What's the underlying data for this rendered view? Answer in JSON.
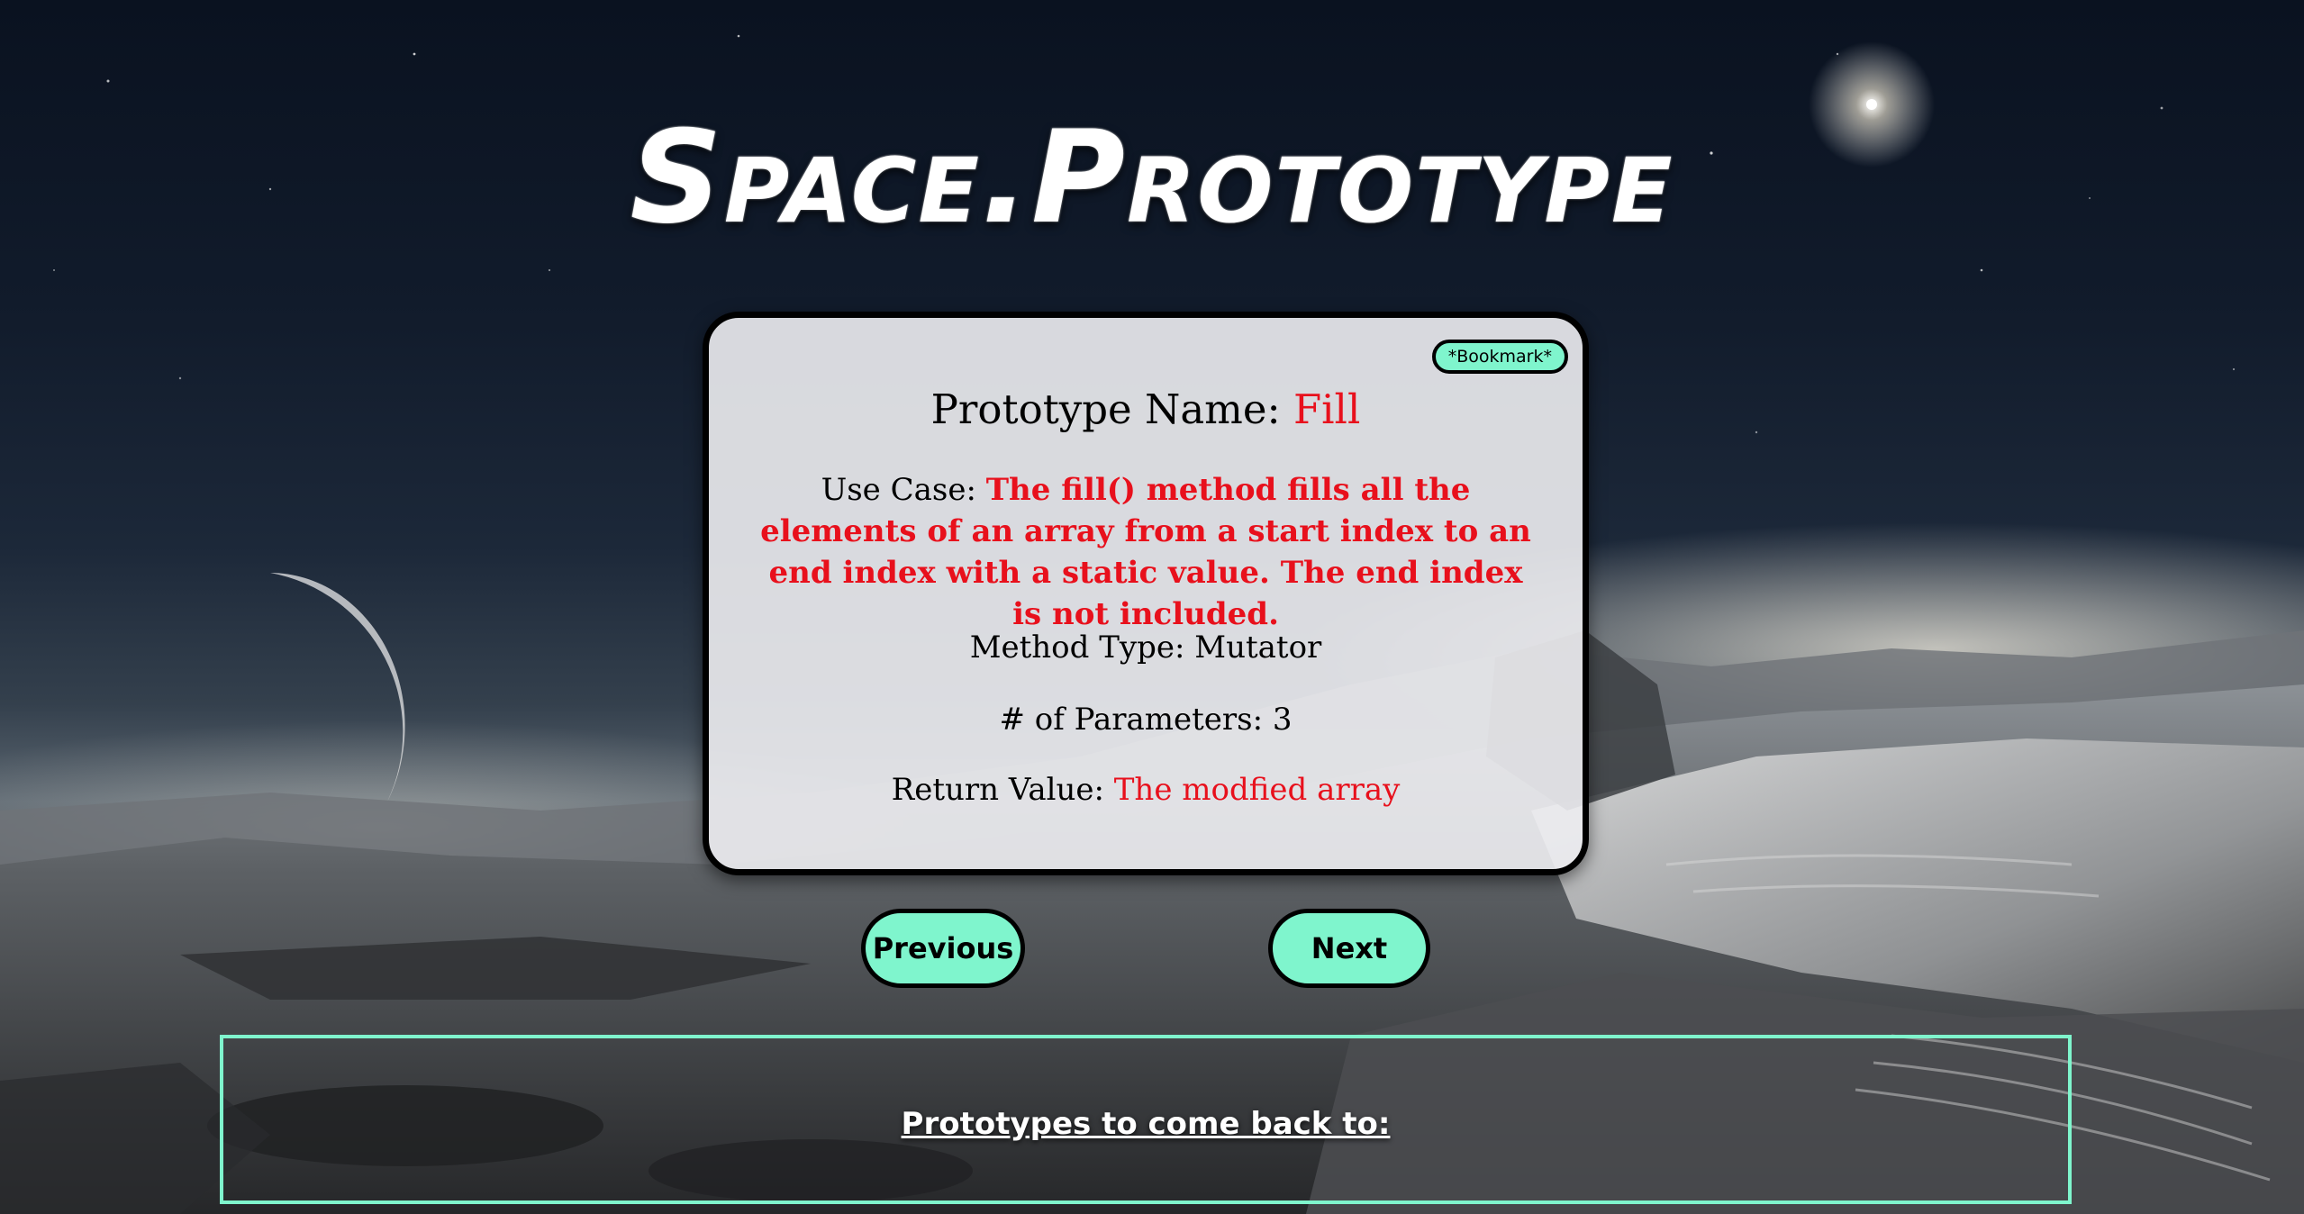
{
  "header": {
    "title": "Space.Prototype"
  },
  "card": {
    "bookmark_label": "*Bookmark*",
    "name_label": "Prototype Name:",
    "name_value": "Fill",
    "use_case_label": "Use Case:",
    "use_case_value": "The fill() method fills all the elements of an array from a start index to an end index with a static value. The end index is not included.",
    "method_type_label": "Method Type:",
    "method_type_value": "Mutator",
    "params_label": "# of Parameters:",
    "params_value": "3",
    "return_label": "Return Value:",
    "return_value": "The modfied array"
  },
  "nav": {
    "previous_label": "Previous",
    "next_label": "Next"
  },
  "bookmarks_panel": {
    "title": "Prototypes to come back to:"
  },
  "colors": {
    "accent": "#7ff5cd",
    "highlight_text": "#e8101c",
    "card_background": "#ececf0",
    "border": "#000000"
  },
  "icons": {
    "background": "space-landscape-illustration"
  }
}
